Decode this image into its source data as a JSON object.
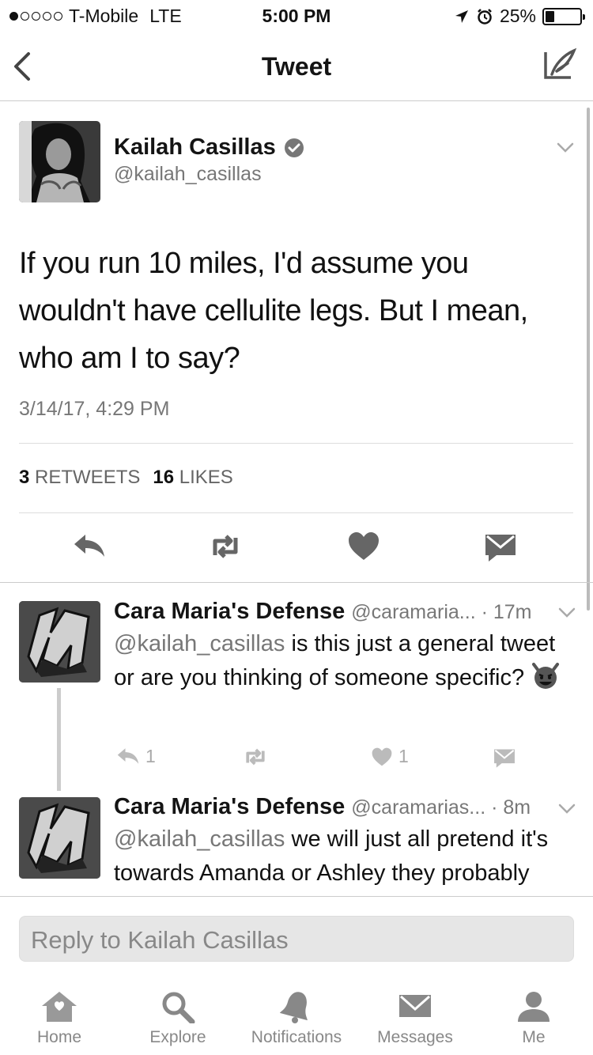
{
  "status_bar": {
    "carrier": "T-Mobile",
    "network": "LTE",
    "time": "5:00 PM",
    "battery": "25%",
    "battery_level": 0.25,
    "signal_bars": 1
  },
  "nav": {
    "title": "Tweet",
    "back_icon": "chevron-left-icon",
    "compose_icon": "compose-tweet-icon"
  },
  "tweet": {
    "author_name": "Kailah Casillas",
    "author_handle": "@kailah_casillas",
    "verified": true,
    "text": "If you run 10 miles, I'd assume you wouldn't have cellulite legs. But I mean, who am I to say?",
    "timestamp": "3/14/17, 4:29 PM",
    "retweets_count": "3",
    "retweets_label": "RETWEETS",
    "likes_count": "16",
    "likes_label": "LIKES"
  },
  "replies": [
    {
      "name": "Cara Maria's Defense",
      "meta": "@caramaria... · 17m",
      "mention": "@kailah_casillas",
      "text": " is this just a general tweet or are you thinking of someone specific?",
      "reply_count": "1",
      "like_count": "1"
    },
    {
      "name": "Cara Maria's Defense",
      "meta": "@caramarias... · 8m",
      "mention": "@kailah_casillas",
      "text": " we will just all pretend it's towards Amanda or Ashley they probably deserve some shade anyways"
    }
  ],
  "reply_box": {
    "placeholder": "Reply to Kailah Casillas"
  },
  "tabs": [
    {
      "label": "Home",
      "icon": "home-icon"
    },
    {
      "label": "Explore",
      "icon": "search-icon"
    },
    {
      "label": "Notifications",
      "icon": "bell-icon"
    },
    {
      "label": "Messages",
      "icon": "envelope-icon"
    },
    {
      "label": "Me",
      "icon": "person-icon"
    }
  ]
}
